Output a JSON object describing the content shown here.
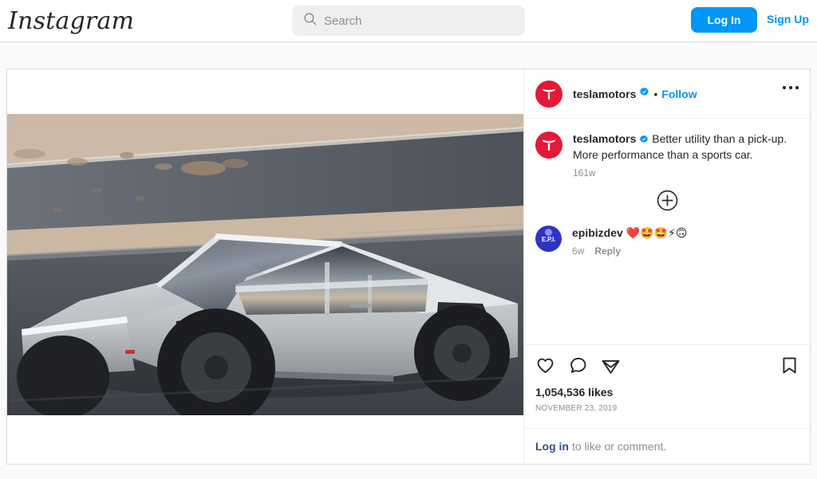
{
  "header": {
    "brand": "Instagram",
    "search": {
      "placeholder": "Search",
      "value": "",
      "icon": "search-icon"
    },
    "login_label": "Log In",
    "signup_label": "Sign Up",
    "accent_color": "#0095f6"
  },
  "post": {
    "author": {
      "username": "teslamotors",
      "verified": true,
      "avatar_color": "#e31937",
      "avatar_glyph": "tesla-t-logo"
    },
    "follow_label": "Follow",
    "separator": "•",
    "more_options_icon": "ellipsis-icon",
    "media": {
      "alt": "Tesla Cybertruck driving on a desert road",
      "type": "video-frame"
    },
    "caption": {
      "username": "teslamotors",
      "verified": true,
      "text": "Better utility than a pick-up. More performance than a sports car.",
      "age": "161w"
    },
    "load_more_icon": "plus-circle-icon",
    "comments": [
      {
        "username": "epibizdev",
        "text": "❤️🤩🤩⚡🙃",
        "age": "6w",
        "reply_label": "Reply",
        "avatar_color": "#2a35c4",
        "avatar_label": "E.P.I."
      }
    ],
    "actions": {
      "like_icon": "heart-icon",
      "comment_icon": "comment-icon",
      "share_icon": "share-icon",
      "save_icon": "bookmark-icon"
    },
    "likes": "1,054,536 likes",
    "date": "NOVEMBER 23, 2019",
    "login_prompt": {
      "link": "Log in",
      "rest": "to like or comment."
    }
  }
}
